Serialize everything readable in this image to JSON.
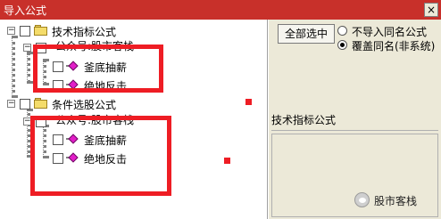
{
  "window": {
    "title": "导入公式",
    "close_label": "×"
  },
  "tree": {
    "group1": {
      "label": "技术指标公式",
      "subgroup_label": "公众号:股市客栈",
      "items": [
        "釜底抽薪",
        "绝地反击"
      ]
    },
    "group2": {
      "label": "条件选股公式",
      "subgroup_label": "公众号:股市客栈",
      "items": [
        "釜底抽薪",
        "绝地反击"
      ]
    }
  },
  "options": {
    "select_all_label": "全部选中",
    "radio_skip_label": "不导入同名公式",
    "radio_overwrite_label": "覆盖同名(非系统)",
    "selected": "overwrite"
  },
  "panel": {
    "title": "技术指标公式"
  },
  "watermark": {
    "text": "股市客栈"
  },
  "colors": {
    "titlebar": "#c8302a",
    "highlight": "#ee1d24",
    "item_icon": "#e21ec8",
    "folder": "#f4dc6a"
  }
}
